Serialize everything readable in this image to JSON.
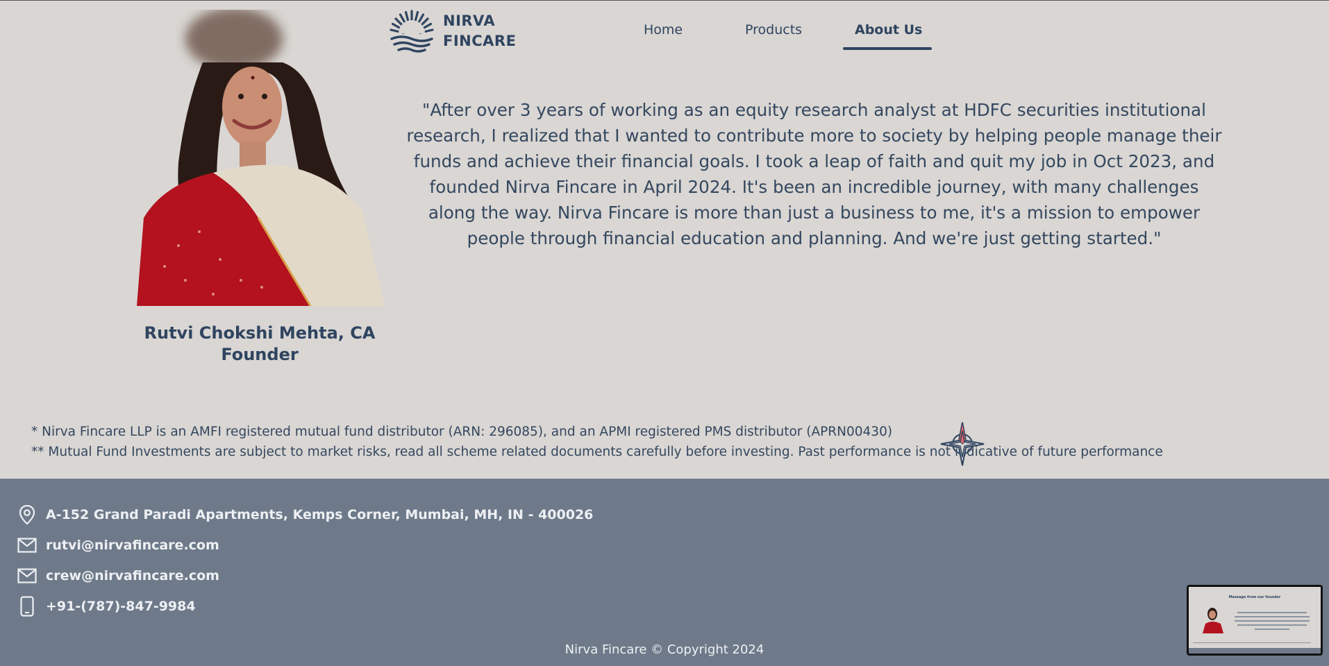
{
  "brand": {
    "line1": "NIRVA",
    "line2": "FINCARE",
    "color": "#2f4460"
  },
  "nav": {
    "items": [
      {
        "label": "Home"
      },
      {
        "label": "Products"
      },
      {
        "label": "About Us",
        "active": true
      }
    ]
  },
  "founder": {
    "name": "Rutvi Chokshi Mehta, CA",
    "role": "Founder",
    "quote": "\"After over 3 years of working as an equity research analyst at HDFC securities institutional research, I realized that I wanted to contribute more to society by helping people manage their funds and achieve their financial goals. I took a leap of faith and quit my job in Oct 2023, and founded Nirva Fincare in April 2024. It's been an incredible journey, with many challenges along the way. Nirva Fincare is more than just a business to me, it's a mission to empower people through financial education and planning. And we're just getting started.\""
  },
  "disclaimers": [
    "* Nirva Fincare LLP is an AMFI registered mutual fund distributor (ARN: 296085), and an APMI registered PMS distributor (APRN00430)",
    "** Mutual Fund Investments are subject to market risks, read all scheme related documents carefully before investing. Past performance is not indicative of future performance"
  ],
  "footer": {
    "address": "A-152 Grand Paradi Apartments, Kemps Corner, Mumbai, MH, IN - 400026",
    "email1": "rutvi@nirvafincare.com",
    "email2": "crew@nirvafincare.com",
    "phone": "+91-(787)-847-9984",
    "copyright": "Nirva Fincare © Copyright 2024",
    "background": "#6e7a8a"
  },
  "icons": [
    "logo-sunrise-icon",
    "location-pin-icon",
    "mail-icon",
    "phone-icon",
    "compass-icon"
  ],
  "thumbnail": {
    "title": "Message from our founder"
  }
}
